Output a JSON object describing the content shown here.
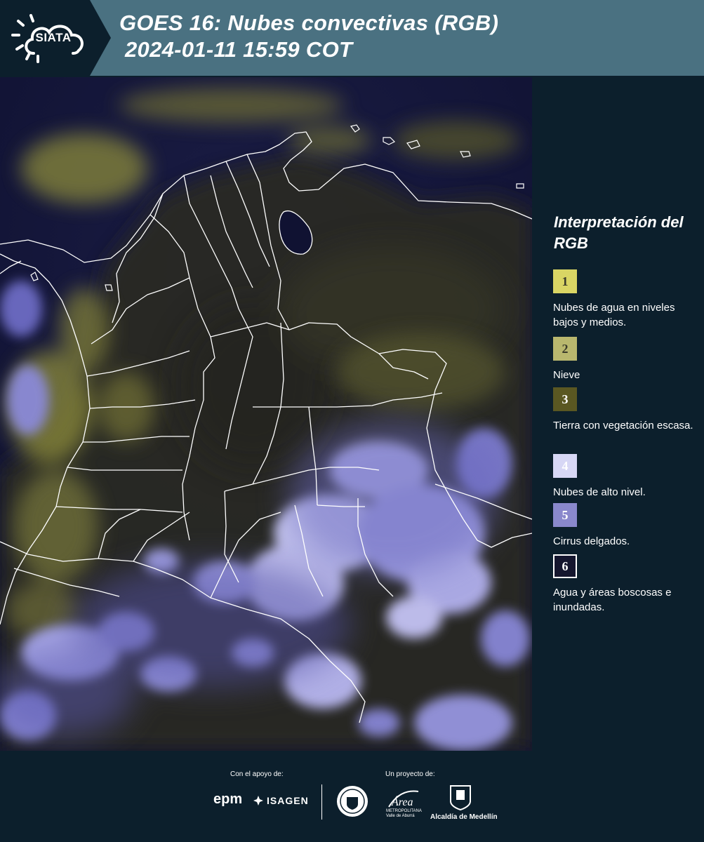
{
  "header": {
    "logo_text": "SIATA",
    "title_line1": "GOES 16: Nubes convectivas (RGB)",
    "title_line2": "2024-01-11 15:59 COT"
  },
  "map": {
    "name": "GOES 16 convective clouds RGB composite over Colombia",
    "border_color": "#ffffff",
    "base_color": "#14163a"
  },
  "legend": {
    "title": "Interpretación del RGB",
    "items": [
      {
        "number": "1",
        "label": "Nubes de agua en niveles bajos y medios.",
        "color": "#d9d564",
        "text_color": "#3a3a2a"
      },
      {
        "number": "2",
        "label": "Nieve",
        "color": "#b9b76e",
        "text_color": "#3a3a2a"
      },
      {
        "number": "3",
        "label": "Tierra con vegetación escasa.",
        "color": "#5a5722",
        "text_color": "#ffffff"
      },
      {
        "number": "4",
        "label": "Nubes de alto nivel.",
        "color": "#d7d7f5",
        "text_color": "#ffffff"
      },
      {
        "number": "5",
        "label": "Cirrus delgados.",
        "color": "#8a88cc",
        "text_color": "#ffffff"
      },
      {
        "number": "6",
        "label": "Agua y áreas boscosas e inundadas.",
        "color": "#15162e",
        "text_color": "#ffffff"
      }
    ]
  },
  "footer": {
    "support_label": "Con el apoyo de:",
    "project_label": "Un proyecto de:",
    "sponsors": [
      "epm",
      "ISAGEN"
    ],
    "area_caption": "METROPOLITANA Valle de Aburrá",
    "area_logo_text": "Área",
    "alcaldia_label": "Alcaldía de Medellín"
  }
}
